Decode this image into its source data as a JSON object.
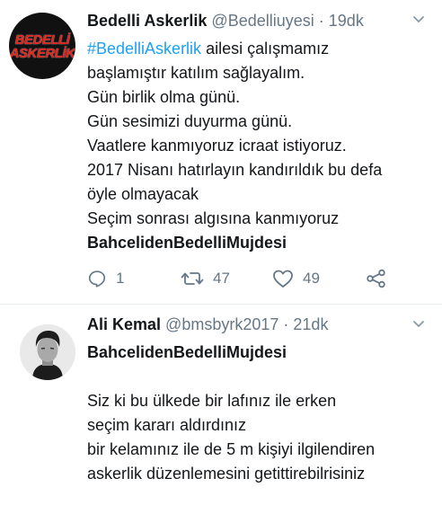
{
  "tweets": [
    {
      "name": "Bedelli Askerlik",
      "handle": "@Bedelliuyesi",
      "separator": "·",
      "time": "19dk",
      "avatar_text": [
        "BEDELLİ",
        "ASKERLİK"
      ],
      "lines": [
        {
          "hashtag": "#BedelliAskerlik",
          "text": " ailesi çalışmamız"
        },
        {
          "text": "başlamıştır katılım sağlayalım."
        },
        {
          "text": "Gün birlik olma günü."
        },
        {
          "text": "Gün sesimizi duyurma günü."
        },
        {
          "text": "Vaatlere kanmıyoruz icraat istiyoruz."
        },
        {
          "text": "2017 Nisanı hatırlayın kandırıldık bu defa"
        },
        {
          "text": "öyle olmayacak"
        },
        {
          "text": "Seçim sonrası algısına kanmıyoruz"
        },
        {
          "bold": "BahcelidenBedelliMujdesi"
        }
      ],
      "actions": {
        "reply": {
          "icon": "reply-icon",
          "count": "1"
        },
        "retweet": {
          "icon": "retweet-icon",
          "count": "47"
        },
        "like": {
          "icon": "heart-icon",
          "count": "49"
        },
        "share": {
          "icon": "share-icon"
        }
      }
    },
    {
      "name": "Ali Kemal",
      "handle": "@bmsbyrk2017",
      "separator": "·",
      "time": "21dk",
      "lines": [
        {
          "bold": "BahcelidenBedelliMujdesi"
        },
        {
          "text": "Siz ki bu ülkede bir lafınız ile erken"
        },
        {
          "text": "seçim kararı aldırdınız"
        },
        {
          "text": "bir kelamınız ile de 5 m kişiyi ilgilendiren"
        },
        {
          "text": "askerlik düzenlemesini getittirebilrisiniz"
        }
      ]
    }
  ],
  "colors": {
    "accent": "#1da1f2",
    "muted": "#657786",
    "text": "#14171a",
    "brand_red": "#e3231b"
  }
}
